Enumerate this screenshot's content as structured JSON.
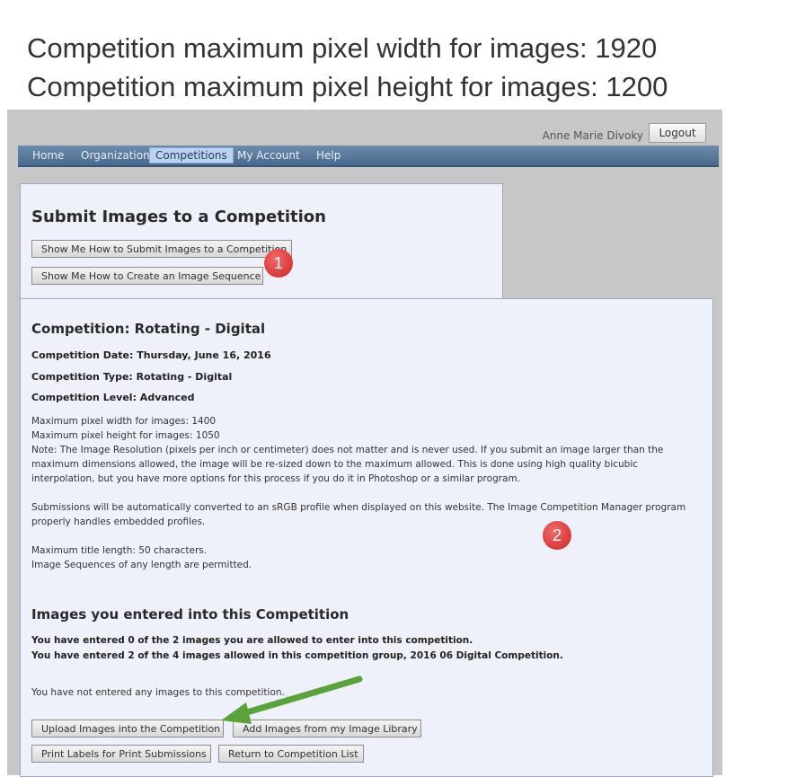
{
  "headline": {
    "line1": "Competition maximum pixel width for images: 1920",
    "line2": "Competition maximum pixel height for images: 1200"
  },
  "header": {
    "user_name": "Anne Marie Divoky",
    "logout_label": "Logout"
  },
  "nav": {
    "items": [
      "Home",
      "Organization",
      "Competitions",
      "My Account",
      "Help"
    ],
    "active": "Competitions"
  },
  "submit_panel": {
    "title": "Submit Images to a Competition",
    "btn_howto_submit": "Show Me How to Submit Images to a Competition",
    "btn_howto_sequence": "Show Me How to Create an Image Sequence"
  },
  "competition": {
    "title": "Competition: Rotating - Digital",
    "date": "Competition Date: Thursday, June 16, 2016",
    "type": "Competition Type: Rotating - Digital",
    "level": "Competition Level: Advanced",
    "para1_line1": "Maximum pixel width for images: 1400",
    "para1_line2": "Maximum pixel height for images: 1050",
    "para1_line3": "Note: The Image Resolution (pixels per inch or centimeter) does not matter and is never used. If you submit an image larger than the maximum dimensions allowed, the image will be re-sized down to the maximum allowed. This is done using high quality bicubic interpolation, but you have more options for this process if you do it in Photoshop or a similar program.",
    "para2": "Submissions will be automatically converted to an sRGB profile when displayed on this website. The Image Competition Manager program properly handles embedded profiles.",
    "para3_line1": "Maximum title length: 50 characters.",
    "para3_line2": "Image Sequences of any length are permitted."
  },
  "entered": {
    "title": "Images you entered into this Competition",
    "line1": "You have entered 0 of the 2 images you are allowed to enter into this competition.",
    "line2": "You have entered 2 of the 4 images allowed in this competition group, 2016 06 Digital Competition.",
    "none": "You have not entered any images to this competition.",
    "btn_upload": "Upload Images into the Competition",
    "btn_library": "Add Images from my Image Library",
    "btn_print": "Print Labels for Print Submissions",
    "btn_return": "Return to Competition List"
  },
  "annotations": {
    "badge1": "1",
    "badge2": "2",
    "badge_color": "#d32222",
    "arrow_color": "#5aa33a"
  }
}
